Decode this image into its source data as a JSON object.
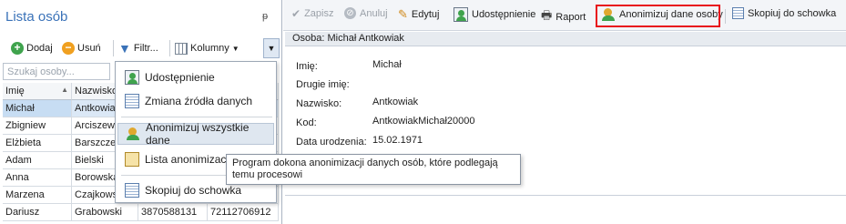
{
  "left_panel": {
    "title": "Lista osób",
    "pin": "ᵽ",
    "toolbar": {
      "add": "Dodaj",
      "remove": "Usuń",
      "filter": "Filtr...",
      "columns": "Kolumny"
    },
    "search_placeholder": "Szukaj osoby...",
    "columns": [
      "Imię",
      "Nazwisko",
      "",
      ""
    ],
    "rows": [
      [
        "Michał",
        "Antkowia",
        "",
        ""
      ],
      [
        "Zbigniew",
        "Arciszews",
        "",
        ""
      ],
      [
        "Elżbieta",
        "Barszczew",
        "",
        ""
      ],
      [
        "Adam",
        "Bielski",
        "",
        ""
      ],
      [
        "Anna",
        "Borowska",
        "",
        ""
      ],
      [
        "Marzena",
        "Czajkows",
        "",
        ""
      ],
      [
        "Dariusz",
        "Grabowski",
        "3870588131",
        "72112706912"
      ]
    ]
  },
  "menu": {
    "items": [
      "Udostępnienie",
      "Zmiana źródła danych",
      "Anonimizuj wszystkie dane",
      "Lista anonimizacji",
      "Skopiuj do schowka"
    ]
  },
  "tooltip": "Program dokona anonimizacji danych osób, które podlegają temu procesowi",
  "toolbar": {
    "save": "Zapisz",
    "cancel": "Anuluj",
    "edit": "Edytuj",
    "share": "Udostępnienie",
    "report": "Raport",
    "anonymize": "Anonimizuj dane osoby",
    "copy": "Skopiuj do schowka"
  },
  "detail": {
    "header": "Osoba: Michał  Antkowiak",
    "fields": [
      {
        "label": "Imię:",
        "value": "Michał"
      },
      {
        "label": "Drugie imię:",
        "value": ""
      },
      {
        "label": "Nazwisko:",
        "value": "Antkowiak"
      },
      {
        "label": "Kod:",
        "value": "AntkowiakMichał20000"
      },
      {
        "label": "Data urodzenia:",
        "value": "15.02.1971"
      }
    ]
  },
  "colors": {
    "highlight": "#e8141c",
    "accent": "#3a72b8",
    "selected_row": "#c7ddf3"
  }
}
